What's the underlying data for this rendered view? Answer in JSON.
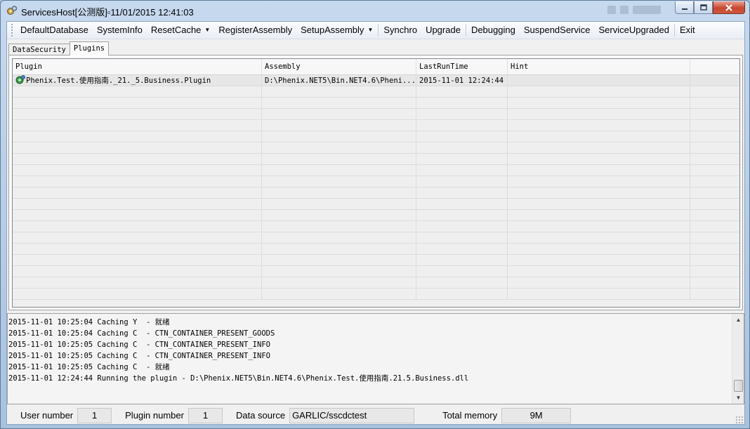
{
  "window": {
    "title": "ServicesHost[公测版]\u000011/01/2015 12:41:03",
    "title_display": "ServicesHost[公测版]▫11/01/2015 12:41:03"
  },
  "menu": {
    "items": [
      {
        "label": "DefaultDatabase"
      },
      {
        "label": "SystemInfo"
      },
      {
        "label": "ResetCache",
        "dropdown": true
      },
      {
        "label": "RegisterAssembly"
      },
      {
        "label": "SetupAssembly",
        "dropdown": true
      },
      {
        "label": "Synchro"
      },
      {
        "label": "Upgrade"
      },
      {
        "label": "Debugging"
      },
      {
        "label": "SuspendService"
      },
      {
        "label": "ServiceUpgraded"
      },
      {
        "label": "Exit"
      }
    ]
  },
  "tabs": [
    {
      "label": "DataSecurity",
      "active": false
    },
    {
      "label": "Plugins",
      "active": true
    }
  ],
  "grid": {
    "columns": [
      "Plugin",
      "Assembly",
      "LastRunTime",
      "Hint",
      ""
    ],
    "rows": [
      {
        "plugin": "Phenix.Test.使用指南._21._5.Business.Plugin",
        "assembly": "D:\\Phenix.NET5\\Bin.NET4.6\\Pheni...",
        "last_run_time": "2015-11-01 12:24:44",
        "hint": ""
      }
    ]
  },
  "log": {
    "lines": [
      "2015-11-01 10:25:04 Caching Y  - 就绪",
      "2015-11-01 10:25:04 Caching C  - CTN_CONTAINER_PRESENT_GOODS",
      "2015-11-01 10:25:05 Caching C  - CTN_CONTAINER_PRESENT_INFO",
      "2015-11-01 10:25:05 Caching C  - CTN_CONTAINER_PRESENT_INFO",
      "2015-11-01 10:25:05 Caching C  - 就绪",
      "2015-11-01 12:24:44 Running the plugin - D:\\Phenix.NET5\\Bin.NET4.6\\Phenix.Test.使用指南.21.5.Business.dll"
    ]
  },
  "status": {
    "user_number_label": "User number",
    "user_number": "1",
    "plugin_number_label": "Plugin number",
    "plugin_number": "1",
    "data_source_label": "Data source",
    "data_source": "GARLIC/sscdctest",
    "total_memory_label": "Total memory",
    "total_memory": "9M"
  },
  "colors": {
    "titlebar": "#b9d1ea",
    "close_button": "#c7462f",
    "client_bg": "#f0f0f0"
  }
}
